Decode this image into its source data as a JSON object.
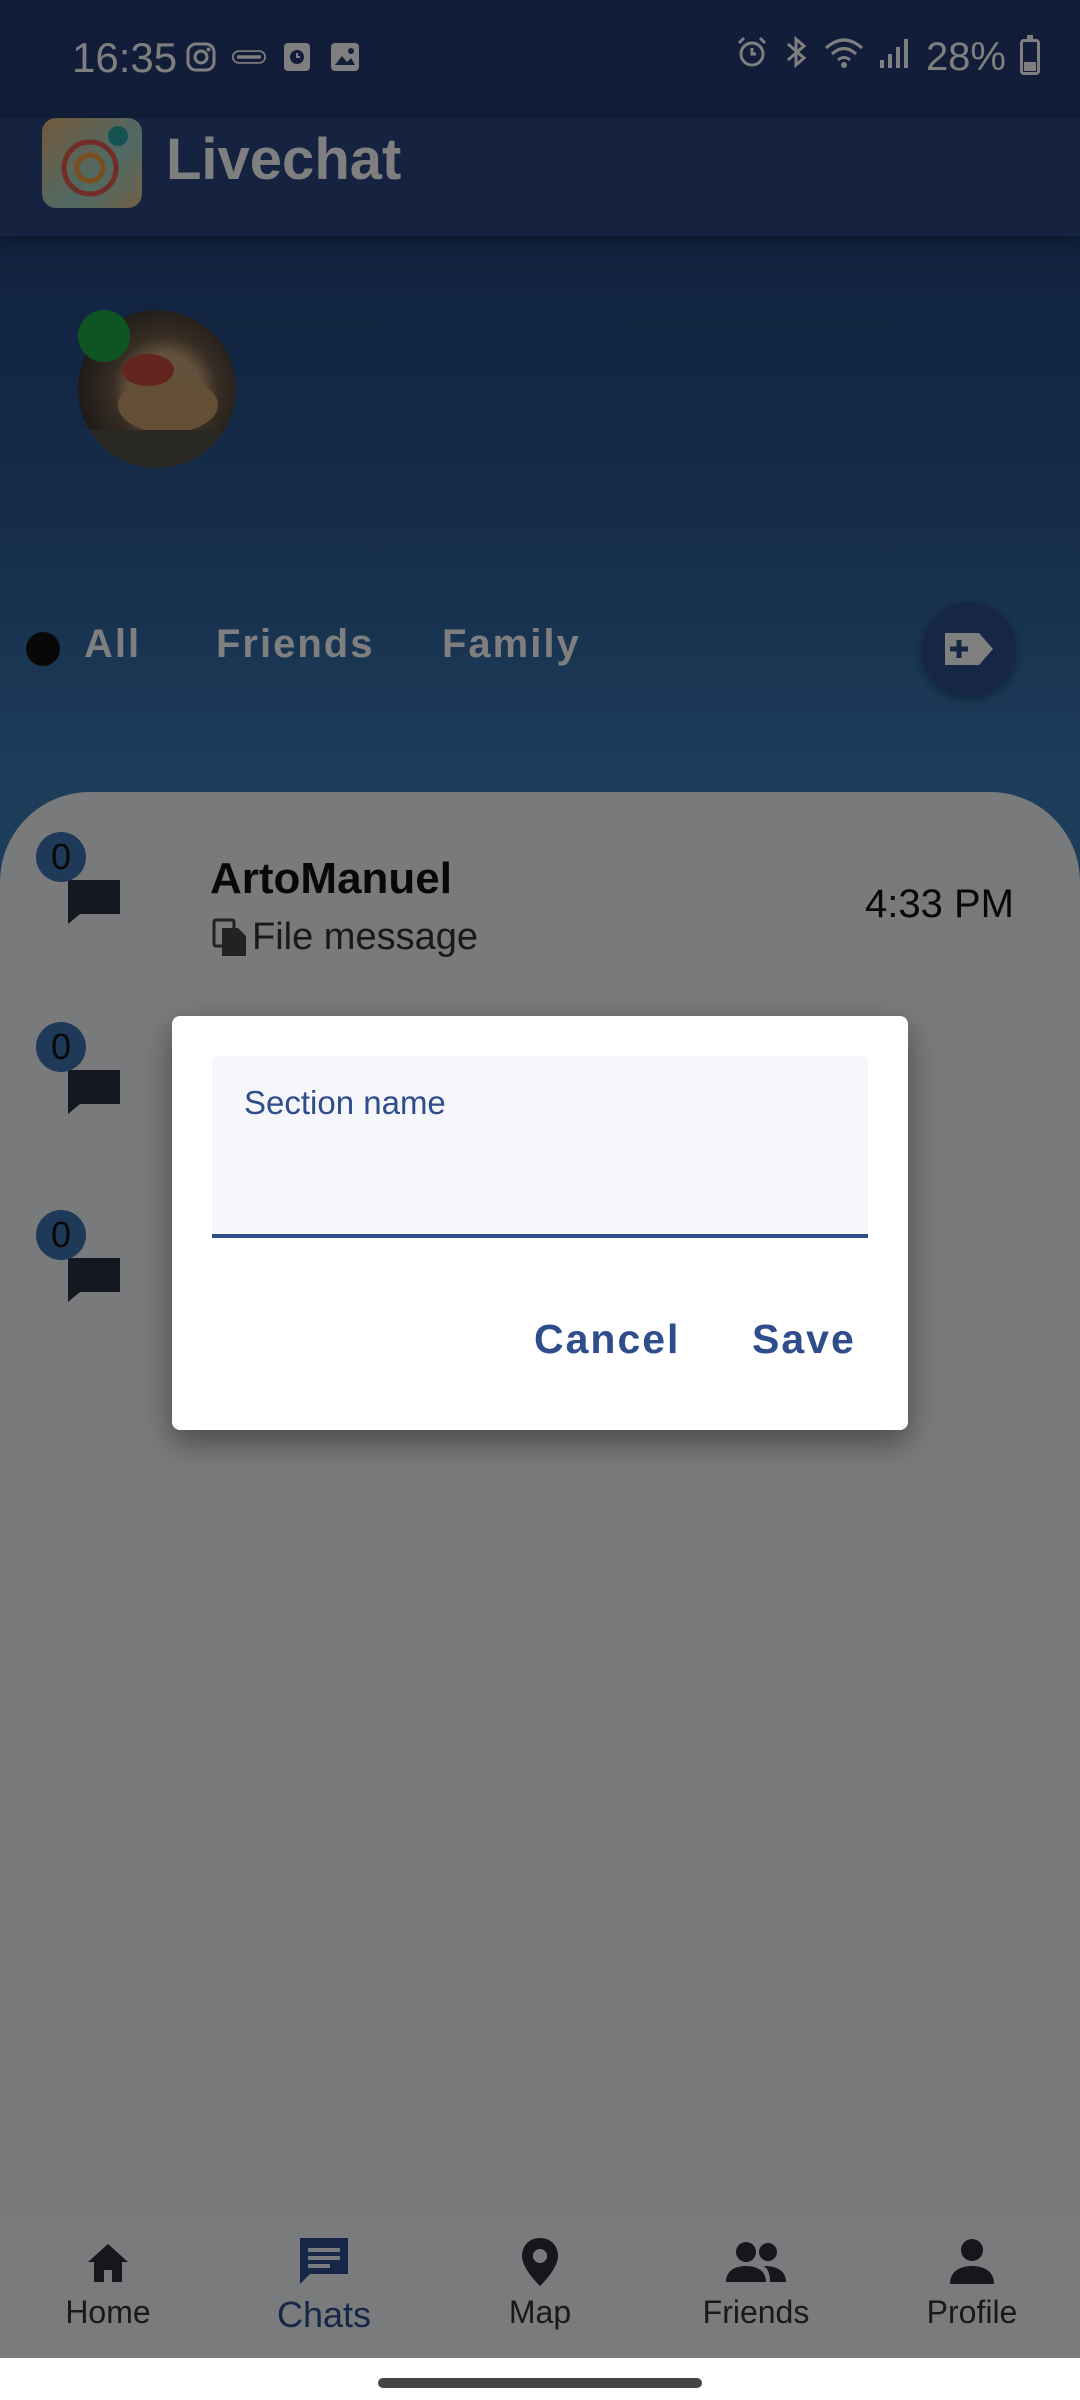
{
  "status_bar": {
    "time": "16:35",
    "battery": "28%",
    "left_icons": [
      "instagram-icon",
      "osm-icon",
      "clock-app-icon",
      "gallery-icon"
    ],
    "right_icons": [
      "alarm-icon",
      "bluetooth-icon",
      "wifi-icon",
      "signal-icon",
      "battery-icon"
    ]
  },
  "app_bar": {
    "title": "Livechat"
  },
  "filters": {
    "tabs": [
      "All",
      "Friends",
      "Family"
    ],
    "selected": "All"
  },
  "chats": [
    {
      "badge": "0",
      "name": "ArtoManuel",
      "preview": "File message",
      "time": "4:33 PM"
    },
    {
      "badge": "0",
      "name": "",
      "preview": "",
      "time": ""
    },
    {
      "badge": "0",
      "name": "",
      "preview": "",
      "time": ""
    }
  ],
  "dialog": {
    "field_label": "Section name",
    "field_value": "",
    "cancel": "Cancel",
    "save": "Save"
  },
  "bottom_nav": [
    {
      "label": "Home",
      "icon": "home-icon"
    },
    {
      "label": "Chats",
      "icon": "chat-icon",
      "active": true
    },
    {
      "label": "Map",
      "icon": "map-pin-icon"
    },
    {
      "label": "Friends",
      "icon": "people-icon"
    },
    {
      "label": "Profile",
      "icon": "person-icon"
    }
  ],
  "colors": {
    "primary": "#2f4c8c",
    "badge": "#3f74b1",
    "online": "#1faa46"
  }
}
